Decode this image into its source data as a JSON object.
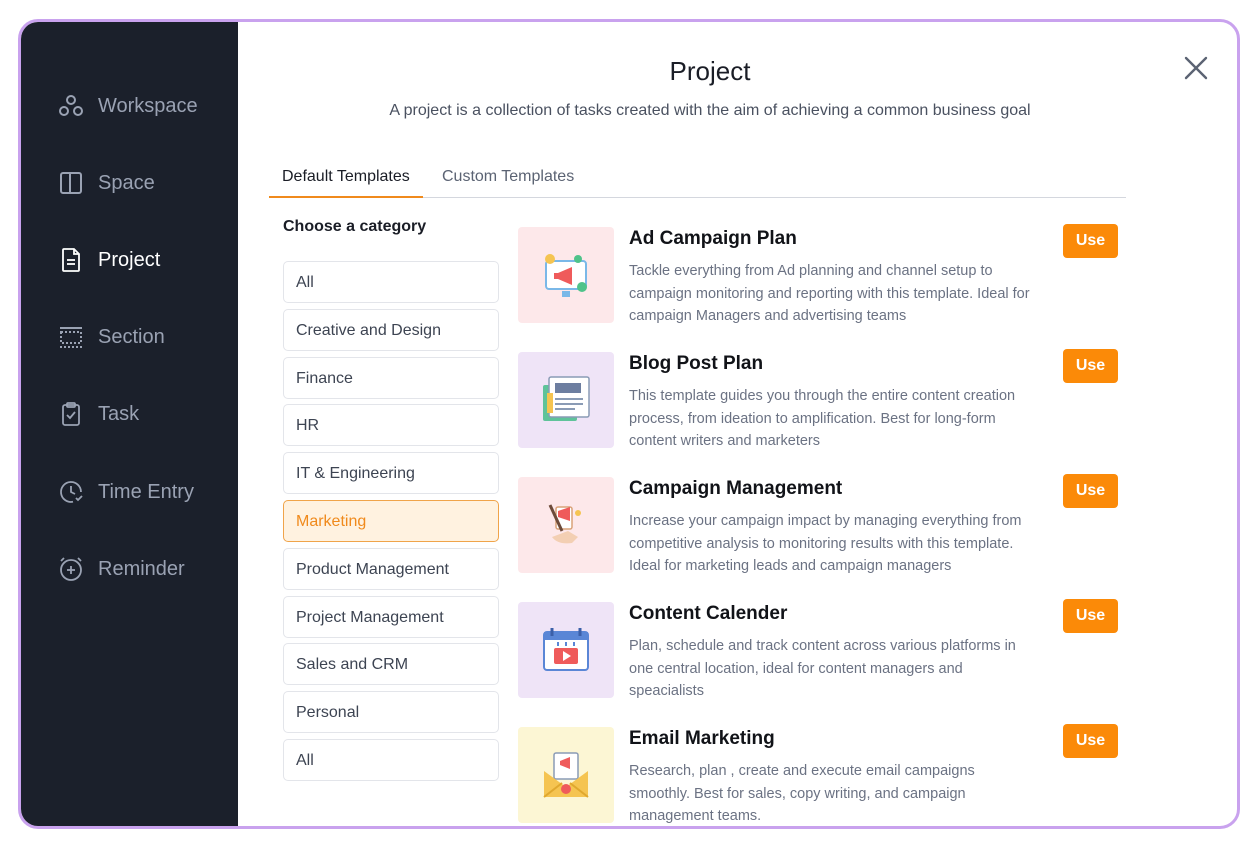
{
  "sidebar": {
    "items": [
      {
        "label": "Workspace",
        "icon": "workspace-icon"
      },
      {
        "label": "Space",
        "icon": "space-icon"
      },
      {
        "label": "Project",
        "icon": "project-icon"
      },
      {
        "label": "Section",
        "icon": "section-icon"
      },
      {
        "label": "Task",
        "icon": "task-icon"
      },
      {
        "label": "Time Entry",
        "icon": "time-entry-icon"
      },
      {
        "label": "Reminder",
        "icon": "reminder-icon"
      }
    ],
    "active": "Project"
  },
  "header": {
    "title": "Project",
    "subtitle": "A project is a collection of tasks created with the aim of achieving a common business goal",
    "close_icon": "close-icon"
  },
  "tabs": [
    {
      "label": "Default Templates",
      "active": true
    },
    {
      "label": "Custom Templates",
      "active": false
    }
  ],
  "categories": {
    "heading": "Choose a category",
    "items": [
      "All",
      "Creative and Design",
      "Finance",
      "HR",
      "IT & Engineering",
      "Marketing",
      "Product Management",
      "Project Management",
      "Sales and CRM",
      "Personal",
      "All"
    ],
    "selected": "Marketing"
  },
  "templates": [
    {
      "title": "Ad Campaign Plan",
      "description": "Tackle everything from Ad planning and channel setup to campaign monitoring and reporting with this template. Ideal for campaign Managers and advertising teams",
      "button": "Use",
      "thumb_bg": "#fde8ea",
      "icon": "ad-campaign-icon"
    },
    {
      "title": "Blog Post Plan",
      "description": "This template guides you through the entire content creation process, from ideation to amplification. Best for long-form content writers and marketers",
      "button": "Use",
      "thumb_bg": "#efe4f7",
      "icon": "blog-icon"
    },
    {
      "title": "Campaign Management",
      "description": "Increase your campaign impact by managing everything from competitive analysis to monitoring results with this template. Ideal for marketing leads and campaign managers",
      "button": "Use",
      "thumb_bg": "#fde8ea",
      "icon": "campaign-management-icon"
    },
    {
      "title": "Content Calender",
      "description": "Plan, schedule and track content across various platforms in one central location, ideal for content managers and speacialists",
      "button": "Use",
      "thumb_bg": "#efe4f7",
      "icon": "content-calendar-icon"
    },
    {
      "title": "Email Marketing",
      "description": "Research, plan , create and execute email campaigns smoothly. Best for sales, copy writing, and campaign management teams.",
      "button": "Use",
      "thumb_bg": "#fcf6d4",
      "icon": "email-marketing-icon"
    }
  ],
  "colors": {
    "accent": "#fb8a08",
    "sidebar_bg": "#1b202b",
    "frame_border": "#c9a2ee",
    "selected_bg": "#fff2e0"
  }
}
